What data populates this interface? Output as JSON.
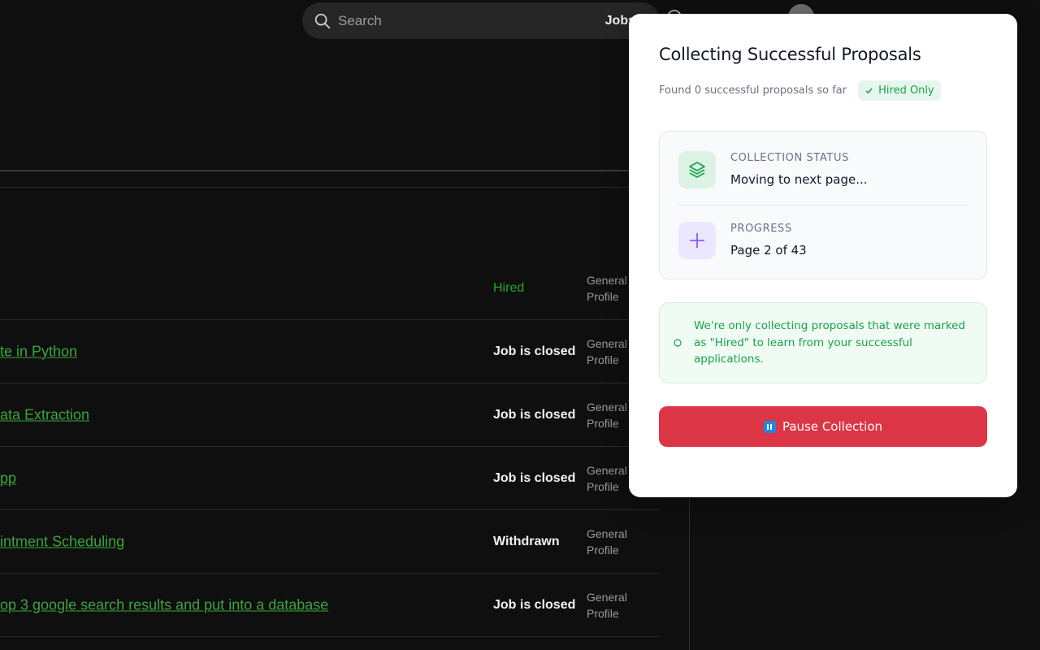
{
  "header": {
    "search": {
      "placeholder": "Search"
    },
    "scope_label": "Jobs"
  },
  "proposals": [
    {
      "title": "",
      "status": "Hired",
      "profile": "General Profile",
      "status_type": "hired"
    },
    {
      "title": "te in Python",
      "status": "Job is closed",
      "profile": "General Profile",
      "status_type": "closed"
    },
    {
      "title": "ata Extraction",
      "status": "Job is closed",
      "profile": "General Profile",
      "status_type": "closed"
    },
    {
      "title": "pp",
      "status": "Job is closed",
      "profile": "General Profile",
      "status_type": "closed"
    },
    {
      "title": "intment Scheduling",
      "status": "Withdrawn",
      "profile": "General Profile",
      "status_type": "withdrawn"
    },
    {
      "title": "op 3 google search results and put into a database",
      "status": "Job is closed",
      "profile": "General Profile",
      "status_type": "closed"
    }
  ],
  "popup": {
    "title": "Collecting Successful Proposals",
    "found_text": "Found 0 successful proposals so far",
    "badge": "Hired Only",
    "collection_status": {
      "label": "COLLECTION STATUS",
      "value": "Moving to next page..."
    },
    "progress": {
      "label": "PROGRESS",
      "value": "Page 2 of 43"
    },
    "info_message": "We're only collecting proposals that were marked as \"Hired\" to learn from your successful applications.",
    "pause_button": "Pause Collection",
    "colors": {
      "accent_green": "#16a34a",
      "danger_red": "#dc3545",
      "purple": "#8b5cf6"
    }
  },
  "icons": {
    "search": "search-icon",
    "jobs_dropdown": "chevron-down-icon",
    "layers": "layers-icon",
    "plus": "plus-icon",
    "info": "circle-icon",
    "check": "check-icon",
    "pause": "pause-icon"
  }
}
